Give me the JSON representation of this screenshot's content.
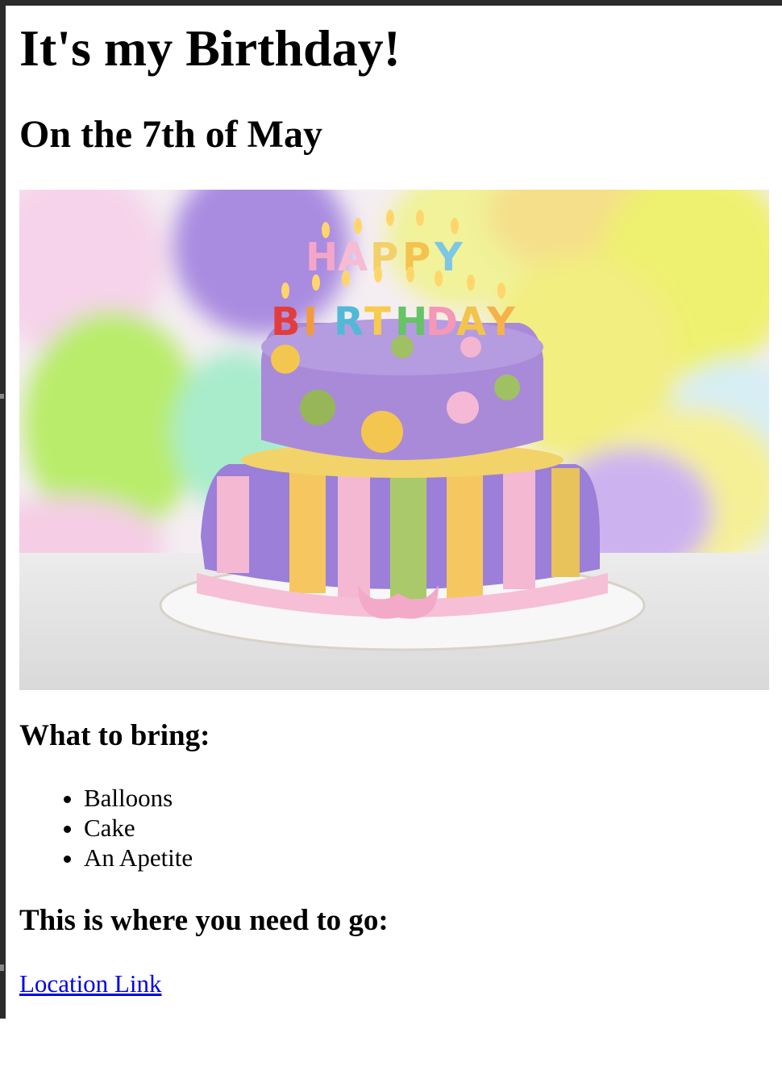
{
  "header": {
    "title": "It's my Birthday!",
    "subtitle": "On the 7th of May"
  },
  "hero_image": {
    "candle_letters": [
      "H",
      "A",
      "P",
      "P",
      "Y",
      "B",
      "I",
      "R",
      "T",
      "H",
      "D",
      "A",
      "Y"
    ]
  },
  "bring": {
    "heading": "What to bring:",
    "items": [
      "Balloons",
      "Cake",
      "An Apetite"
    ]
  },
  "location": {
    "heading": "This is where you need to go:",
    "link_text": "Location Link"
  }
}
